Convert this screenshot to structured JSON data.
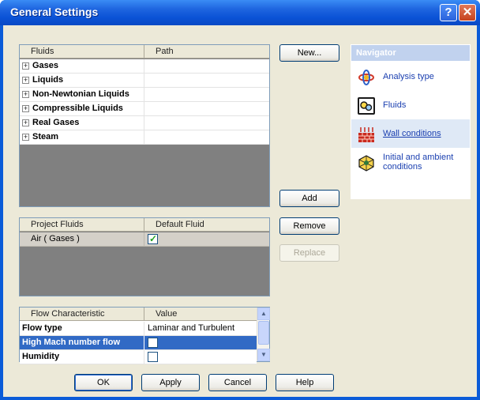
{
  "window": {
    "title": "General Settings",
    "help_glyph": "?",
    "close_glyph": "✕"
  },
  "fluids": {
    "headers": [
      "Fluids",
      "Path"
    ],
    "items": [
      "Gases",
      "Liquids",
      "Non-Newtonian Liquids",
      "Compressible Liquids",
      "Real Gases",
      "Steam"
    ],
    "expand_glyph": "+"
  },
  "project_fluids": {
    "headers": [
      "Project Fluids",
      "Default Fluid"
    ],
    "rows": [
      {
        "name": "Air ( Gases )",
        "default": true
      }
    ]
  },
  "flow": {
    "headers": [
      "Flow Characteristic",
      "Value"
    ],
    "rows": [
      {
        "name": "Flow type",
        "value": "Laminar and Turbulent"
      },
      {
        "name": "High Mach number flow",
        "value": ""
      },
      {
        "name": "Humidity",
        "value": ""
      }
    ]
  },
  "buttons": {
    "new": "New...",
    "add": "Add",
    "remove": "Remove",
    "replace": "Replace"
  },
  "footer": {
    "ok": "OK",
    "apply": "Apply",
    "cancel": "Cancel",
    "help": "Help"
  },
  "navigator": {
    "title": "Navigator",
    "items": [
      {
        "label": "Analysis type",
        "icon": "analysis-type-icon"
      },
      {
        "label": "Fluids",
        "icon": "fluids-icon"
      },
      {
        "label": "Wall conditions",
        "icon": "wall-conditions-icon"
      },
      {
        "label": "Initial and ambient conditions",
        "icon": "initial-conditions-icon"
      }
    ]
  },
  "colors": {
    "title_bar": "#0a52d6",
    "selection": "#316ac5",
    "dialog_bg": "#ece9d8",
    "link": "#1a3fb0"
  }
}
